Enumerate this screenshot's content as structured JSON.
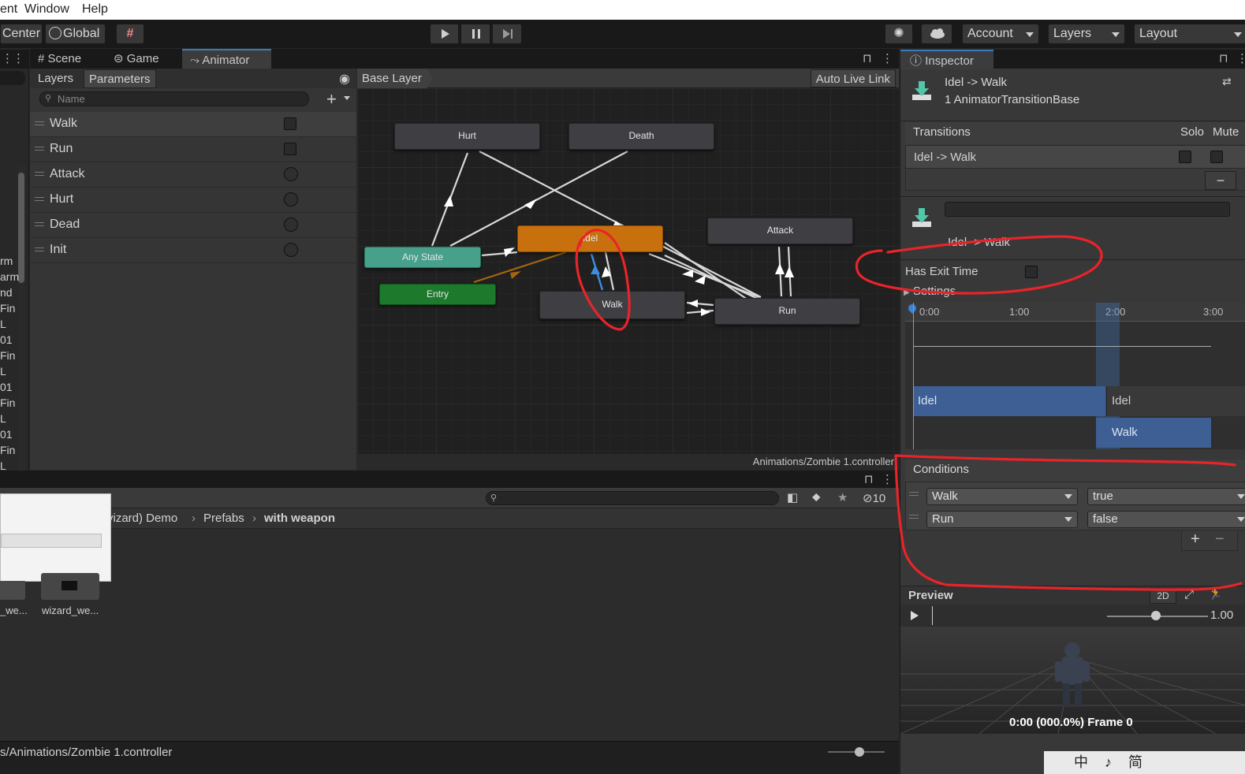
{
  "menubar": {
    "items": [
      "ent",
      "Window",
      "Help"
    ]
  },
  "toolbar": {
    "pivot_label": "Center",
    "space_label": "Global",
    "account_label": "Account",
    "layers_label": "Layers",
    "layout_label": "Layout"
  },
  "tabs": {
    "scene": "Scene",
    "game": "Game",
    "animator": "Animator",
    "inspector": "Inspector"
  },
  "animator": {
    "subtabs": {
      "layers": "Layers",
      "parameters": "Parameters"
    },
    "search_placeholder": "Name",
    "breadcrumb": "Base Layer",
    "auto_live_link": "Auto Live Link",
    "footer_path": "Animations/Zombie 1.controller",
    "parameters": [
      {
        "name": "Walk",
        "kind": "bool"
      },
      {
        "name": "Run",
        "kind": "bool"
      },
      {
        "name": "Attack",
        "kind": "trigger"
      },
      {
        "name": "Hurt",
        "kind": "trigger"
      },
      {
        "name": "Dead",
        "kind": "trigger"
      },
      {
        "name": "Init",
        "kind": "trigger"
      }
    ],
    "nodes": {
      "hurt": "Hurt",
      "death": "Death",
      "idel": "Idel",
      "attack": "Attack",
      "any_state": "Any State",
      "entry": "Entry",
      "walk": "Walk",
      "run": "Run"
    }
  },
  "hierarchy_side": [
    "rm",
    "arm",
    "nd",
    "Fin",
    "L",
    "01",
    "Fin",
    "L",
    "01",
    "Fin",
    "L",
    "01",
    "Fin",
    "L"
  ],
  "inspector": {
    "title": "Idel -> Walk",
    "subtitle": "1 AnimatorTransitionBase",
    "transitions_header": "Transitions",
    "solo": "Solo",
    "mute": "Mute",
    "transition_item": "Idel -> Walk",
    "transition_name_value": "",
    "transition_label": "Idel -> Walk",
    "has_exit_time": "Has Exit Time",
    "settings": "Settings",
    "timeline_ticks": [
      "0:00",
      "1:00",
      "2:00",
      "3:00"
    ],
    "timeline_clips": {
      "source_a": "Idel",
      "source_b": "Idel",
      "dest": "Walk"
    },
    "conditions_header": "Conditions",
    "conditions": [
      {
        "param": "Walk",
        "value": "true"
      },
      {
        "param": "Run",
        "value": "false"
      }
    ],
    "preview_label": "Preview",
    "preview_2d": "2D",
    "preview_speed": "1.00",
    "preview_time": "0:00 (000.0%) Frame 0"
  },
  "project": {
    "breadcrumb": [
      "vizard) Demo",
      "Prefabs",
      "with weapon"
    ],
    "hidden_count": "10",
    "assets": [
      "_we...",
      "wizard_we..."
    ]
  },
  "status_path": "s/Animations/Zombie 1.controller",
  "ime_bar": "中 ♪ 简"
}
